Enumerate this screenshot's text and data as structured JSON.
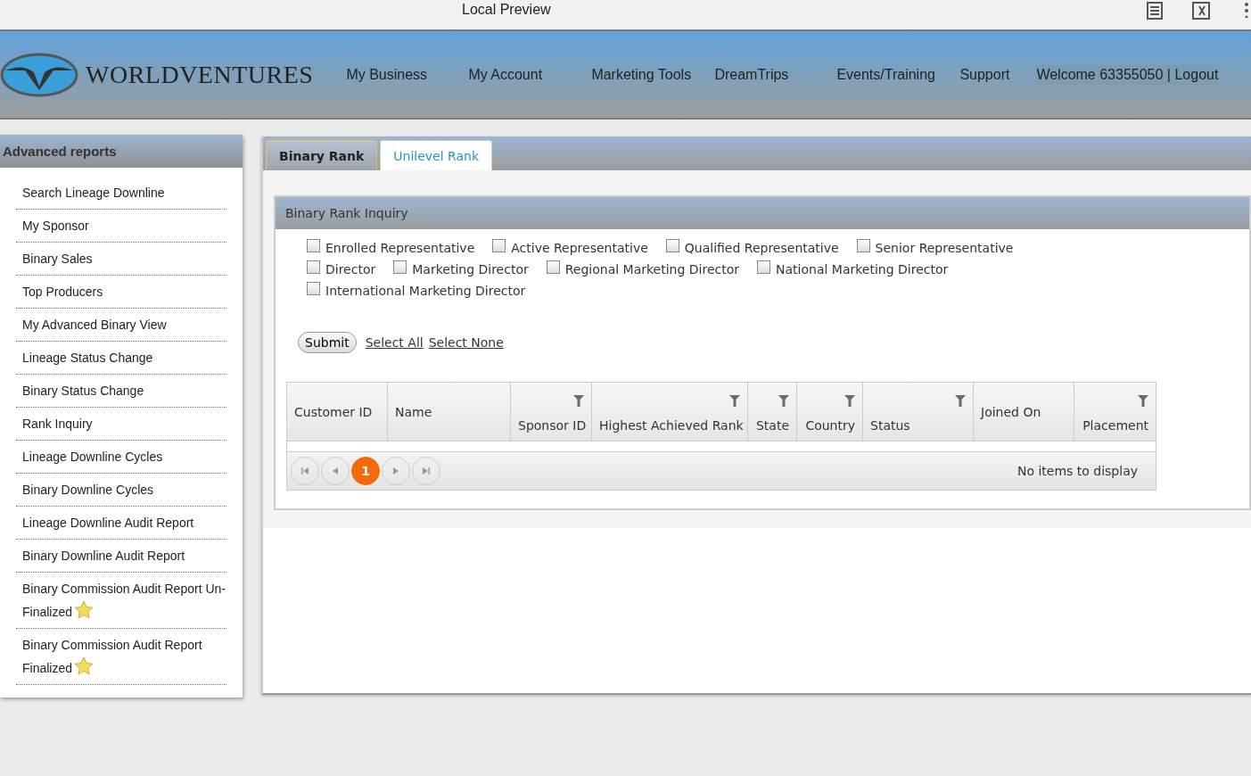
{
  "window": {
    "title": "Local Preview"
  },
  "header": {
    "logo_text": "WORLDVENTURES",
    "nav": [
      "My Business",
      "My Account",
      "Marketing Tools",
      "DreamTrips",
      "Events/Training",
      "Support"
    ],
    "welcome": "Welcome 63355050",
    "logout": "| Logout"
  },
  "sidebar": {
    "title": "Advanced reports",
    "items": [
      {
        "label": "Search Lineage Downline",
        "starred": false
      },
      {
        "label": "My Sponsor",
        "starred": false
      },
      {
        "label": "Binary Sales",
        "starred": false
      },
      {
        "label": "Top Producers",
        "starred": false
      },
      {
        "label": "My Advanced Binary View",
        "starred": false
      },
      {
        "label": "Lineage Status Change",
        "starred": false
      },
      {
        "label": "Binary Status Change",
        "starred": false
      },
      {
        "label": "Rank Inquiry",
        "starred": false
      },
      {
        "label": "Lineage Downline Cycles",
        "starred": false
      },
      {
        "label": "Binary Downline Cycles",
        "starred": false
      },
      {
        "label": "Lineage Downline Audit Report",
        "starred": false
      },
      {
        "label": "Binary Downline Audit Report",
        "starred": false
      },
      {
        "label": "Binary Commission Audit Report Un-Finalized",
        "starred": true
      },
      {
        "label": "Binary Commission Audit Report Finalized",
        "starred": true
      }
    ]
  },
  "tabs": [
    {
      "label": "Binary Rank",
      "selected": true
    },
    {
      "label": "Unilevel Rank",
      "selected": false
    }
  ],
  "panel": {
    "title": "Binary Rank Inquiry",
    "rank_rows": [
      [
        {
          "label": "Enrolled Representative",
          "checked": false
        },
        {
          "label": "Active Representative",
          "checked": false
        },
        {
          "label": "Qualified Representative",
          "checked": false
        },
        {
          "label": "Senior Representative",
          "checked": false
        }
      ],
      [
        {
          "label": "Director",
          "checked": false
        },
        {
          "label": "Marketing Director",
          "checked": false
        },
        {
          "label": "Regional Marketing Director",
          "checked": false
        },
        {
          "label": "National Marketing Director",
          "checked": false
        }
      ],
      [
        {
          "label": "International Marketing Director",
          "checked": false
        }
      ]
    ],
    "submit": "Submit",
    "select_all": "Select All",
    "select_none": "Select None"
  },
  "table": {
    "columns": [
      {
        "label": "Customer ID",
        "filter": false
      },
      {
        "label": "Name",
        "filter": false
      },
      {
        "label": "Sponsor ID",
        "filter": true
      },
      {
        "label": "Highest Achieved Rank",
        "filter": true
      },
      {
        "label": "State",
        "filter": true
      },
      {
        "label": "Country",
        "filter": true
      },
      {
        "label": "Status",
        "filter": true
      },
      {
        "label": "Joined On",
        "filter": false
      },
      {
        "label": "Placement",
        "filter": true
      }
    ],
    "pager": {
      "pages": [
        {
          "label": "1",
          "selected": true
        }
      ],
      "info": "No items to display"
    }
  }
}
